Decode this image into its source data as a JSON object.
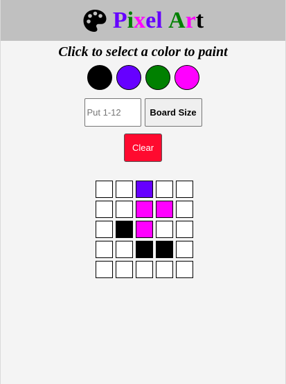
{
  "header": {
    "title_letters": [
      {
        "char": "P",
        "color": "#6600ff"
      },
      {
        "char": "i",
        "color": "#008000"
      },
      {
        "char": "x",
        "color": "#ff00ff"
      },
      {
        "char": "e",
        "color": "#6600ff"
      },
      {
        "char": "l",
        "color": "#6600ff"
      },
      {
        "char": " ",
        "color": "#000000"
      },
      {
        "char": "A",
        "color": "#008000"
      },
      {
        "char": "r",
        "color": "#ff00ff"
      },
      {
        "char": "t",
        "color": "#000000"
      }
    ],
    "icon": "palette-icon"
  },
  "subtitle": "Click to select a color to paint",
  "colors": [
    "#000000",
    "#6600ff",
    "#008000",
    "#ff00ff"
  ],
  "board_controls": {
    "size_placeholder": "Put 1-12",
    "size_value": "",
    "board_size_label": "Board Size"
  },
  "clear_label": "Clear",
  "board": {
    "rows": [
      [
        "#ffffff",
        "#ffffff",
        "#6600ff",
        "#ffffff",
        "#ffffff"
      ],
      [
        "#ffffff",
        "#ffffff",
        "#ff00ff",
        "#ff00ff",
        "#ffffff"
      ],
      [
        "#ffffff",
        "#000000",
        "#ff00ff",
        "#ffffff",
        "#ffffff"
      ],
      [
        "#ffffff",
        "#ffffff",
        "#000000",
        "#000000",
        "#ffffff"
      ],
      [
        "#ffffff",
        "#ffffff",
        "#ffffff",
        "#ffffff",
        "#ffffff"
      ]
    ]
  }
}
